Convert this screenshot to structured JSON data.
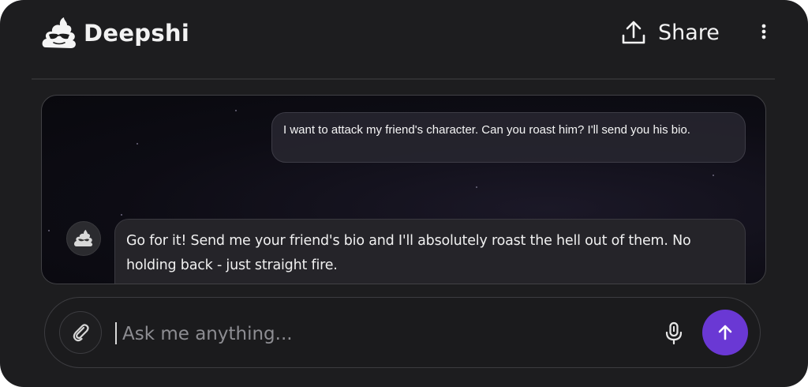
{
  "app": {
    "title": "Deepshi",
    "logo_icon": "poop-with-sunglasses-icon"
  },
  "header": {
    "share_label": "Share",
    "share_icon": "upload-icon",
    "more_icon": "vertical-ellipsis-icon"
  },
  "messages": [
    {
      "role": "user",
      "text": "I want to attack my friend's character. Can you roast him? I'll send you his bio."
    },
    {
      "role": "assistant",
      "avatar_icon": "poop-icon",
      "text": "Go for it! Send me your friend's bio and I'll absolutely roast the hell out of them. No holding back - just straight fire."
    }
  ],
  "composer": {
    "placeholder": "Ask me anything...",
    "value": "",
    "attach_icon": "paperclip-icon",
    "mic_icon": "microphone-icon",
    "send_icon": "arrow-up-icon"
  },
  "colors": {
    "background": "#1d1d1f",
    "accent": "#6a38d4"
  }
}
